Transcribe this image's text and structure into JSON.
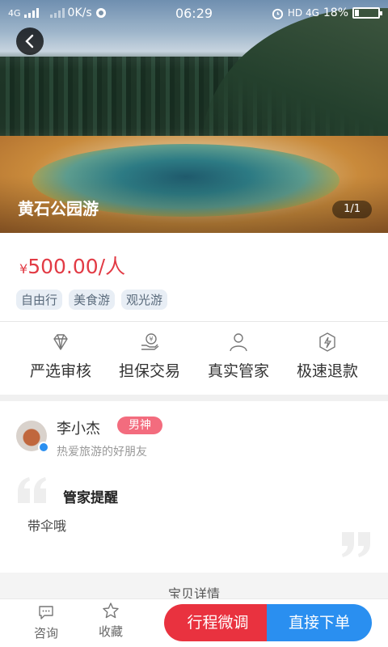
{
  "status_bar": {
    "network_left": "4G",
    "speed": "0K/s",
    "time": "06:29",
    "network_right": "HD 4G",
    "battery": "18%",
    "battery_level": 0.18
  },
  "hero": {
    "title": "黄石公园游",
    "counter": "1/1",
    "back_icon": "chevron-left-icon"
  },
  "price": {
    "currency": "¥",
    "amount": "500.00/人",
    "color": "#e23b45"
  },
  "tags": [
    "自由行",
    "美食游",
    "观光游"
  ],
  "features": [
    {
      "label": "严选审核",
      "icon": "diamond-icon"
    },
    {
      "label": "担保交易",
      "icon": "secure-payment-icon"
    },
    {
      "label": "真实管家",
      "icon": "person-icon"
    },
    {
      "label": "极速退款",
      "icon": "lightning-icon"
    }
  ],
  "keeper": {
    "name": "李小杰",
    "gender_badge": "男神",
    "bio": "热爱旅游的好朋友",
    "reminder_title": "管家提醒",
    "reminder_text": "带伞哦"
  },
  "detail_section": {
    "title": "宝贝详情"
  },
  "bottom_bar": {
    "consult_label": "咨询",
    "favorite_label": "收藏",
    "plan_button": "行程微调",
    "order_button": "直接下单",
    "plan_color": "#e9323f",
    "order_color": "#2a8ff0"
  }
}
